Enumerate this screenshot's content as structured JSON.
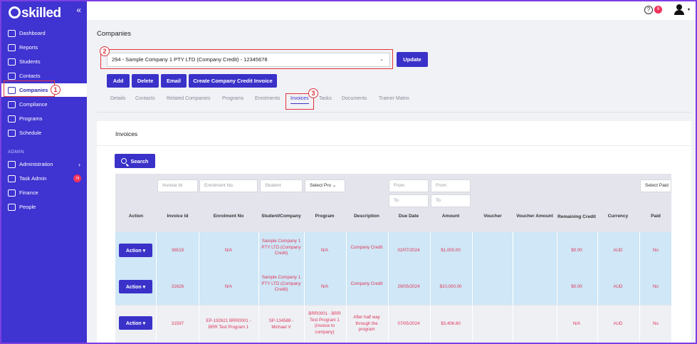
{
  "app": {
    "logo": "skilled",
    "collapse_glyph": "«"
  },
  "sidebar": {
    "items": [
      {
        "label": "Dashboard",
        "icon": "chart-line-icon"
      },
      {
        "label": "Reports",
        "icon": "report-icon"
      },
      {
        "label": "Students",
        "icon": "users-icon"
      },
      {
        "label": "Contacts",
        "icon": "contacts-icon"
      },
      {
        "label": "Companies",
        "icon": "building-icon",
        "active": true
      },
      {
        "label": "Compliance",
        "icon": "compliance-icon"
      },
      {
        "label": "Programs",
        "icon": "programs-icon"
      },
      {
        "label": "Schedule",
        "icon": "calendar-icon"
      }
    ],
    "admin_label": "ADMIN",
    "admin_items": [
      {
        "label": "Administration",
        "icon": "admin-icon"
      },
      {
        "label": "Task Admin",
        "icon": "tasks-icon",
        "badge": "79"
      },
      {
        "label": "Finance",
        "icon": "finance-icon"
      },
      {
        "label": "People",
        "icon": "people-icon"
      }
    ]
  },
  "topbar": {
    "help": "?",
    "notification_count": "8"
  },
  "page": {
    "title": "Companies"
  },
  "company_select": {
    "value": "294 - Sample Company 1 PTY LTD (Company Credit) - 12345678"
  },
  "buttons": {
    "update": "Update",
    "add": "Add",
    "delete": "Delete",
    "email": "Email",
    "credit_invoice": "Create Company Credit Invoice",
    "search": "Search"
  },
  "tabs": [
    "Details",
    "Contacts",
    "Related Companies",
    "Programs",
    "Enrolments",
    "Invoices",
    "Tasks",
    "Documents",
    "Trainer Matrix"
  ],
  "callouts": [
    "1",
    "2",
    "3"
  ],
  "invoices": {
    "title": "Invoices",
    "filters": {
      "invoice_id": "Invoice Id",
      "enrolment_no": "Enrolment No.",
      "student": "Student",
      "program": "Select Pro",
      "due_from": "From",
      "due_to": "To",
      "amount_from": "From",
      "amount_to": "To",
      "paid": "Select Paid"
    },
    "columns": [
      "Action",
      "Invoice Id",
      "Enrolment No",
      "Student/Company",
      "Program",
      "Description",
      "Due Date",
      "Amount",
      "Voucher",
      "Voucher Amount",
      "Remaining Credit",
      "Currency",
      "Paid"
    ],
    "action_label": "Action ▾",
    "rows": [
      {
        "invoice_id": "36519",
        "enrolment_no": "N/A",
        "student": "Sample Company 1 PTY LTD (Company Credit)",
        "program": "N/A",
        "description": "Company Credit",
        "due_date": "02/07/2024",
        "amount": "$1,000.00",
        "voucher": "",
        "voucher_amount": "",
        "remaining_credit": "$0.00",
        "currency": "AUD",
        "paid": "No"
      },
      {
        "invoice_id": "31626",
        "enrolment_no": "N/A",
        "student": "Sample Company 1 PTY LTD (Company Credit)",
        "program": "N/A",
        "description": "Company Credit",
        "due_date": "29/05/2024",
        "amount": "$10,000.00",
        "voucher": "",
        "voucher_amount": "",
        "remaining_credit": "$0.00",
        "currency": "AUD",
        "paid": "No"
      },
      {
        "invoice_id": "31597",
        "enrolment_no": "EP-192621 BRR0001 - BRR Test Program 1",
        "student": "SP-134588 - Michael V",
        "program": "BRR0001 - BRR Test Program 1 (invoice to company)",
        "description": "After half way through the program",
        "due_date": "07/05/2024",
        "amount": "$3,406.80",
        "voucher": "",
        "voucher_amount": "",
        "remaining_credit": "N/A",
        "currency": "AUD",
        "paid": "No"
      }
    ]
  },
  "colors": {
    "sidebar": "#3f33d1",
    "primary": "#3a31c9",
    "highlight": "#e0363a",
    "row_blue": "#cfe7f6",
    "link_red": "#e0365a"
  }
}
